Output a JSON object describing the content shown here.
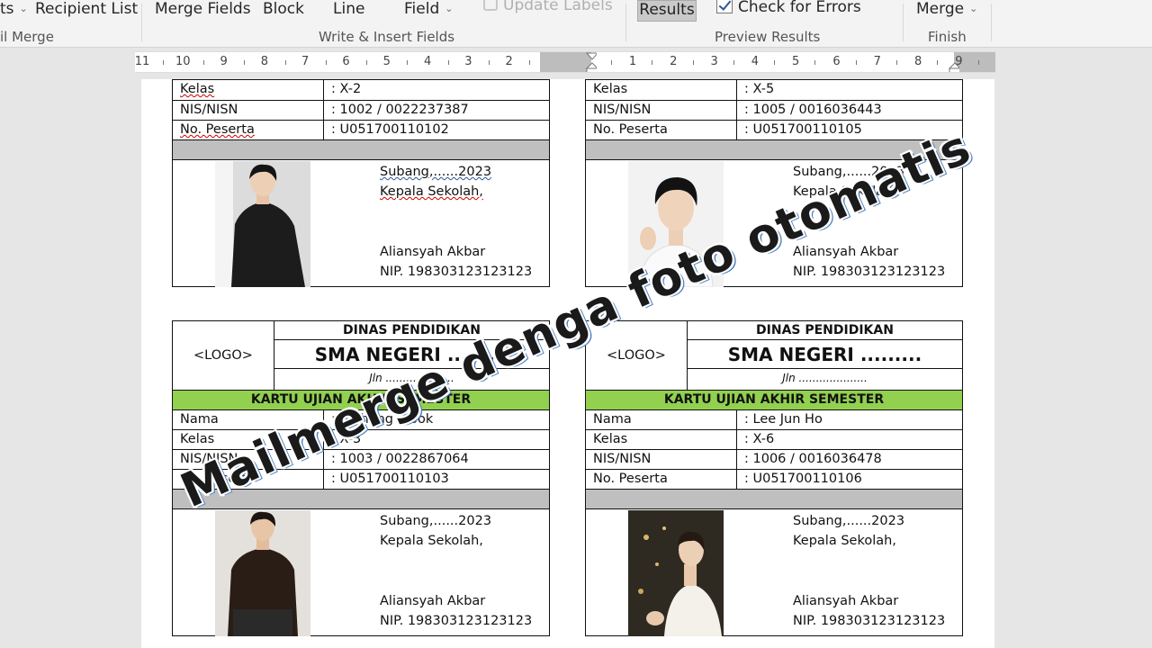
{
  "ribbon": {
    "start_partial": "ts",
    "recipient_list": "Recipient List",
    "mail_merge_partial": "il Merge",
    "merge_fields": "Merge Fields",
    "block": "Block",
    "line": "Line",
    "field": "Field",
    "update_labels": "Update Labels",
    "results": "Results",
    "check_errors": "Check for Errors",
    "merge": "Merge",
    "group_write": "Write & Insert Fields",
    "group_preview": "Preview Results",
    "group_finish": "Finish"
  },
  "ruler": {
    "left_numbers": [
      "11",
      "10",
      "9",
      "8",
      "7",
      "6",
      "5",
      "4",
      "3",
      "2"
    ],
    "right_numbers": [
      "1",
      "2",
      "3",
      "4",
      "5",
      "6",
      "7",
      "8",
      "9"
    ]
  },
  "cards": [
    {
      "kelas_label": "Kelas",
      "kelas": ": X-2",
      "nis_label": "NIS/NISN",
      "nis": ": 1002 / 0022237387",
      "peserta_label": "No. Peserta",
      "peserta": ": U051700110102",
      "sig_place": "Subang,......2023",
      "sig_role": "Kepala Sekolah,",
      "sig_name": "Aliansyah Akbar",
      "sig_nip": "NIP. 198303123123123"
    },
    {
      "kelas_label": "Kelas",
      "kelas": ": X-5",
      "nis_label": "NIS/NISN",
      "nis": ": 1005 / 0016036443",
      "peserta_label": "No. Peserta",
      "peserta": ": U051700110105",
      "sig_place": "Subang,......2023",
      "sig_role": "Kepala Sekolah,",
      "sig_name": "Aliansyah Akbar",
      "sig_nip": "NIP. 198303123123123"
    },
    {
      "logo": "<LOGO>",
      "dinas": "DINAS PENDIDIKAN",
      "school": "SMA NEGERI .........",
      "jln": "Jln ....................",
      "kartu": "KARTU UJIAN AKHIR SEMESTER",
      "nama_label": "Nama",
      "nama": ": Ji Chang Wook",
      "kelas_label": "Kelas",
      "kelas": ": X-3",
      "nis_label": "NIS/NISN",
      "nis": ": 1003 / 0022867064",
      "peserta_label": "No. Peserta",
      "peserta": ": U051700110103",
      "sig_place": "Subang,......2023",
      "sig_role": "Kepala Sekolah,",
      "sig_name": "Aliansyah Akbar",
      "sig_nip": "NIP. 198303123123123"
    },
    {
      "logo": "<LOGO>",
      "dinas": "DINAS PENDIDIKAN",
      "school": "SMA NEGERI .........",
      "jln": "Jln ....................",
      "kartu": "KARTU UJIAN AKHIR SEMESTER",
      "nama_label": "Nama",
      "nama": ": Lee Jun Ho",
      "kelas_label": "Kelas",
      "kelas": ": X-6",
      "nis_label": "NIS/NISN",
      "nis": ": 1006 / 0016036478",
      "peserta_label": "No. Peserta",
      "peserta": ": U051700110106",
      "sig_place": "Subang,......2023",
      "sig_role": "Kepala Sekolah,",
      "sig_name": "Aliansyah Akbar",
      "sig_nip": "NIP. 198303123123123"
    }
  ],
  "overlay_text": "Mailmerge denga foto otomatis",
  "colors": {
    "kartu_green": "#92d050",
    "gray_band": "#bfbfbf",
    "ribbon_bg": "#f3f3f3",
    "overlay_outline": "#4a7fc1"
  }
}
